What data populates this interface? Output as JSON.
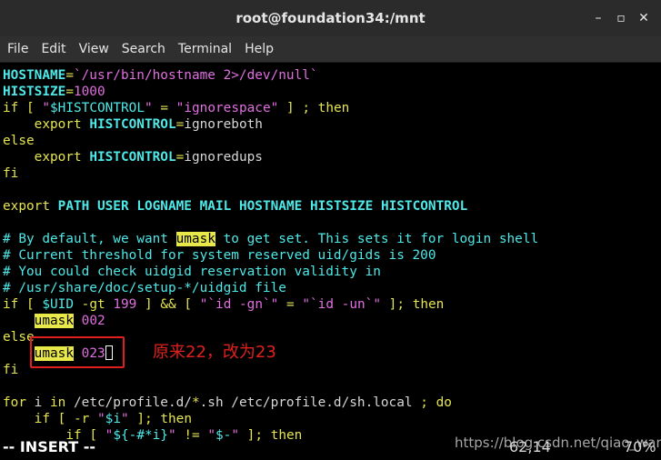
{
  "window": {
    "title": "root@foundation34:/mnt",
    "buttons": [
      "–",
      "▫",
      "✕"
    ]
  },
  "menu": [
    "File",
    "Edit",
    "View",
    "Search",
    "Terminal",
    "Help"
  ],
  "editor": {
    "lines": [
      [
        "HOSTNAME=`/usr/bin/hostname 2>/dev/null`"
      ],
      [
        "HISTSIZE=1000"
      ],
      [
        "if [ \"$HISTCONTROL\" = \"ignorespace\" ] ; then"
      ],
      [
        "    export HISTCONTROL=ignoreboth"
      ],
      [
        "else"
      ],
      [
        "    export HISTCONTROL=ignoredups"
      ],
      [
        "fi"
      ],
      [
        ""
      ],
      [
        "export PATH USER LOGNAME MAIL HOSTNAME HISTSIZE HISTCONTROL"
      ],
      [
        ""
      ],
      [
        "# By default, we want umask to get set. This sets it for login shell"
      ],
      [
        "# Current threshold for system reserved uid/gids is 200"
      ],
      [
        "# You could check uidgid reservation validity in"
      ],
      [
        "# /usr/share/doc/setup-*/uidgid file"
      ],
      [
        "if [ $UID -gt 199 ] && [ \"`id -gn`\" = \"`id -un`\" ]; then"
      ],
      [
        "    umask 002"
      ],
      [
        "else"
      ],
      [
        "    umask 023"
      ],
      [
        "fi"
      ],
      [
        ""
      ],
      [
        "for i in /etc/profile.d/*.sh /etc/profile.d/sh.local ; do"
      ],
      [
        "    if [ -r \"$i\" ]; then"
      ],
      [
        "        if [ \"${-#*i}\" != \"$-\" ]; then"
      ]
    ]
  },
  "annotation": "原来22，改为23",
  "status": {
    "mode": "-- INSERT --",
    "position": "62,14",
    "percent": "70%"
  },
  "watermark": "https://blog.csdn.net/qiao_wang"
}
